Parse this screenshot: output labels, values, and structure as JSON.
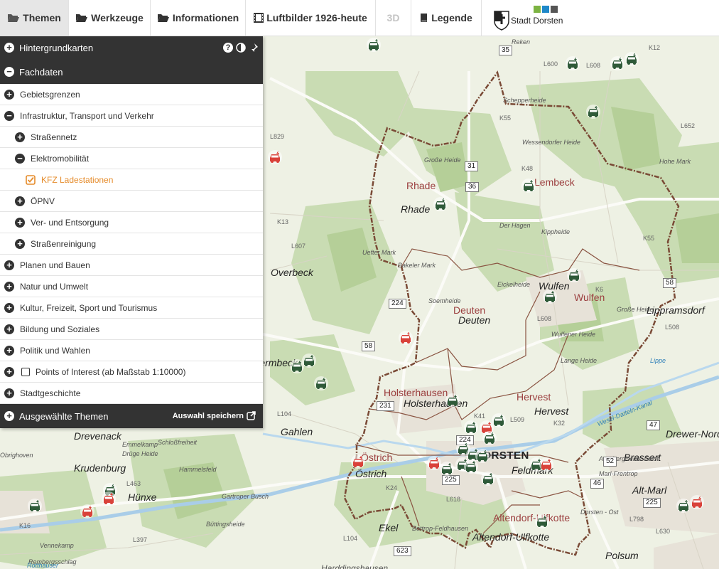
{
  "toolbar": {
    "themen": "Themen",
    "werkzeuge": "Werkzeuge",
    "informationen": "Informationen",
    "luftbilder": "Luftbilder 1926-heute",
    "threed": "3D",
    "legende": "Legende",
    "stadt": "Stadt Dorsten",
    "swatches": [
      "#7cb342",
      "#1e88c9",
      "#555555"
    ]
  },
  "panel": {
    "hintergrund": "Hintergrundkarten",
    "fachdaten": "Fachdaten",
    "items": [
      {
        "label": "Gebietsgrenzen",
        "level": 0,
        "state": "plus"
      },
      {
        "label": "Infrastruktur, Transport und Verkehr",
        "level": 0,
        "state": "minus"
      },
      {
        "label": "Straßennetz",
        "level": 1,
        "state": "plus"
      },
      {
        "label": "Elektromobilität",
        "level": 1,
        "state": "minus"
      },
      {
        "label": "KFZ Ladestationen",
        "level": 2,
        "state": "checked"
      },
      {
        "label": "ÖPNV",
        "level": 1,
        "state": "plus"
      },
      {
        "label": "Ver- und Entsorgung",
        "level": 1,
        "state": "plus"
      },
      {
        "label": "Straßenreinigung",
        "level": 1,
        "state": "plus"
      },
      {
        "label": "Planen und Bauen",
        "level": 0,
        "state": "plus"
      },
      {
        "label": "Natur und Umwelt",
        "level": 0,
        "state": "plus"
      },
      {
        "label": "Kultur, Freizeit, Sport und Tourismus",
        "level": 0,
        "state": "plus"
      },
      {
        "label": "Bildung und Soziales",
        "level": 0,
        "state": "plus"
      },
      {
        "label": "Politik und Wahlen",
        "level": 0,
        "state": "plus"
      },
      {
        "label": "Points of Interest (ab Maßstab 1:10000)",
        "level": 0,
        "state": "plus-checkbox"
      },
      {
        "label": "Stadtgeschichte",
        "level": 0,
        "state": "plus"
      }
    ],
    "ausgewaehlt": "Ausgewählte Themen",
    "speichern": "Auswahl speichern"
  },
  "map": {
    "places": [
      {
        "text": "Rhade",
        "style": "italic"
      },
      {
        "text": "Rhade",
        "style": "red"
      },
      {
        "text": "Lembeck",
        "style": "red"
      },
      {
        "text": "Overbeck",
        "style": "italic"
      },
      {
        "text": "Wulfen",
        "style": "italic"
      },
      {
        "text": "Wulfen",
        "style": "red"
      },
      {
        "text": "Lippramsdorf",
        "style": "italic"
      },
      {
        "text": "Deuten",
        "style": "red"
      },
      {
        "text": "Deuten",
        "style": "italic"
      },
      {
        "text": "Holsterhausen",
        "style": "red"
      },
      {
        "text": "Holsterhausen",
        "style": "italic"
      },
      {
        "text": "Hervest",
        "style": "red"
      },
      {
        "text": "Hervest",
        "style": "italic"
      },
      {
        "text": "Gahlen",
        "style": "italic"
      },
      {
        "text": "Drevenack",
        "style": "italic"
      },
      {
        "text": "Krudenburg",
        "style": "italic"
      },
      {
        "text": "Hünxe",
        "style": "italic"
      },
      {
        "text": "Östrich",
        "style": "red"
      },
      {
        "text": "Östrich",
        "style": "italic"
      },
      {
        "text": "DORSTEN",
        "style": "big"
      },
      {
        "text": "Feldmark",
        "style": "italic"
      },
      {
        "text": "Brassert",
        "style": "italic"
      },
      {
        "text": "Alt-Marl",
        "style": "italic"
      },
      {
        "text": "Drewer-Nord",
        "style": "italic"
      },
      {
        "text": "Altendorf-Ulfkotte",
        "style": "red"
      },
      {
        "text": "Altendorf-Ulfkotte",
        "style": "italic"
      },
      {
        "text": "Ekel",
        "style": "italic"
      },
      {
        "text": "Polsum",
        "style": "italic"
      },
      {
        "text": "Schermbeck",
        "style": "italic"
      }
    ],
    "small": [
      "Reken",
      "Schepperheide",
      "Wessendorfer Heide",
      "Große Heide",
      "Hohe Mark",
      "Der Hagen",
      "Kippheide",
      "Uefter Mark",
      "Bakeler Mark",
      "Soemheide",
      "Eickelheide",
      "Große Heide",
      "Wulfener Heide",
      "Lange Heide",
      "Emmelkamp",
      "Drüge Heide",
      "Schloßfreiheit",
      "Hammelsfeld",
      "Gartroper Busch",
      "Büttingsheide",
      "Rembergsschlag",
      "Vennekamp",
      "Arenbergischer Forst",
      "Marl-Frentrop",
      "Dorsten - Ost",
      "Bottrop-Feldhausen",
      "Harddingshausen",
      "Wesel-Datteln-Kanal",
      "Lippe",
      "Rotthauser",
      "Obrighoven"
    ],
    "roads": [
      "35",
      "31",
      "36",
      "224",
      "58",
      "58",
      "52",
      "46",
      "47",
      "225",
      "225",
      "224",
      "231",
      "623"
    ],
    "roadnums": [
      "K12",
      "L600",
      "L608",
      "L652",
      "K55",
      "K48",
      "L829",
      "K13",
      "L607",
      "L508",
      "K6",
      "L608",
      "K55",
      "L509",
      "K32",
      "L104",
      "L463",
      "K16",
      "L397",
      "L618",
      "K24",
      "L104",
      "L798",
      "L630",
      "K41"
    ]
  }
}
